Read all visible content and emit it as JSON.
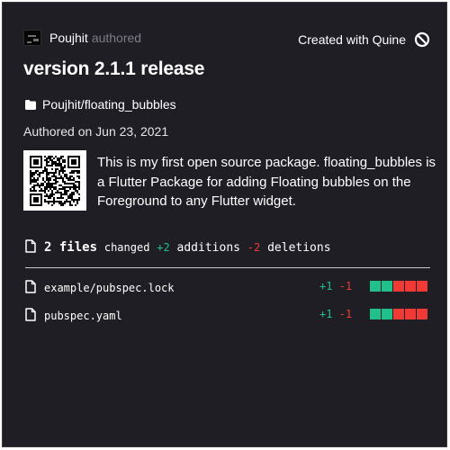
{
  "header": {
    "author": "Poujhit",
    "authored_label": "authored",
    "created_with": "Created with Quine",
    "quine_icon": "quine-logo-icon"
  },
  "commit": {
    "title": "version 2.1.1 release",
    "repo": "Poujhit/floating_bubbles",
    "date": "Authored on Jun 23, 2021",
    "message": "This is my first open source package. floating_bubbles is a Flutter Package for adding Floating bubbles on the Foreground to any Flutter widget."
  },
  "stats": {
    "files_count": "2 files",
    "changed_label": "changed",
    "additions": "+2",
    "additions_label": "additions",
    "deletions": "-2",
    "deletions_label": "deletions"
  },
  "files": [
    {
      "name": "example/pubspec.lock",
      "additions": "+1",
      "deletions": "-1",
      "bar": [
        "add",
        "add",
        "del",
        "del",
        "del"
      ]
    },
    {
      "name": "pubspec.yaml",
      "additions": "+1",
      "deletions": "-1",
      "bar": [
        "add",
        "add",
        "del",
        "del",
        "del"
      ]
    }
  ],
  "colors": {
    "background": "#1f1e24",
    "addition": "#21c08b",
    "deletion": "#ef3a36",
    "muted": "#7d7d86"
  }
}
